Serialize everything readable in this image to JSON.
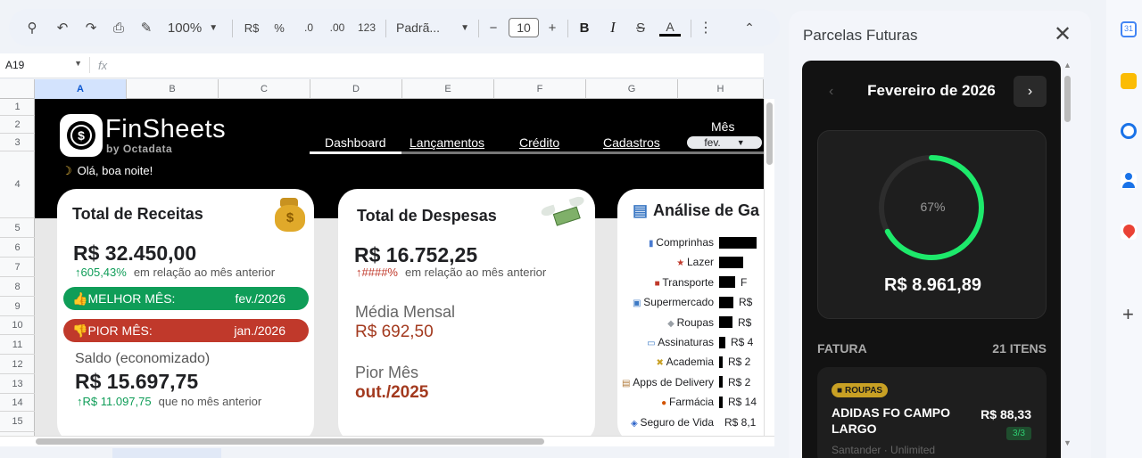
{
  "toolbar": {
    "zoom": "100%",
    "currency": "R$",
    "percent": "%",
    "dec_less": ".0",
    "dec_more": ".00",
    "num_format": "123",
    "font": "Padrã...",
    "font_size": "10",
    "bold": "B",
    "italic": "I",
    "strike": "S",
    "text_color": "A"
  },
  "formula_bar": {
    "cell_ref": "A19",
    "fx": "fx"
  },
  "columns": [
    "A",
    "B",
    "C",
    "D",
    "E",
    "F",
    "G",
    "H"
  ],
  "rows": [
    "1",
    "2",
    "3",
    "4",
    "5",
    "6",
    "7",
    "8",
    "9",
    "10",
    "11",
    "12",
    "13",
    "14",
    "15"
  ],
  "dashboard": {
    "logo_title": "FinSheets",
    "logo_sub": "by Octadata",
    "greeting": "Olá, boa noite!",
    "nav": [
      "Dashboard",
      "Lançamentos",
      "Crédito",
      "Cadastros"
    ],
    "month_label": "Mês",
    "month_value": "fev.",
    "receitas": {
      "title": "Total de Receitas",
      "value": "R$ 32.450,00",
      "change": "605,43%",
      "change_note": "em relação ao mês anterior",
      "best_label": "MELHOR MÊS:",
      "best_value": "fev./2026",
      "worst_label": "PIOR MÊS:",
      "worst_value": "jan./2026",
      "saldo_label": "Saldo (economizado)",
      "saldo_value": "R$ 15.697,75",
      "saldo_change": "R$ 11.097,75",
      "saldo_note": "que no mês anterior"
    },
    "despesas": {
      "title": "Total de Despesas",
      "value": "R$ 16.752,25",
      "change": "####%",
      "change_note": "em relação ao mês anterior",
      "media_label": "Média Mensal",
      "media_value": "R$ 692,50",
      "pior_label": "Pior Mês",
      "pior_value": "out./2025"
    },
    "analise": {
      "title": "Análise de Ga",
      "items": [
        {
          "label": "Comprinhas",
          "value": "",
          "bar": 0.95,
          "icon": "bag-icon"
        },
        {
          "label": "Lazer",
          "value": "",
          "bar": 0.62,
          "icon": "party-icon"
        },
        {
          "label": "Transporte",
          "value": "F",
          "bar": 0.4,
          "icon": "truck-icon"
        },
        {
          "label": "Supermercado",
          "value": "R$",
          "bar": 0.36,
          "icon": "cart-icon"
        },
        {
          "label": "Roupas",
          "value": "R$",
          "bar": 0.34,
          "icon": "shirt-icon"
        },
        {
          "label": "Assinaturas",
          "value": "R$ 4",
          "bar": 0.17,
          "icon": "screen-icon"
        },
        {
          "label": "Academia",
          "value": "R$ 2",
          "bar": 0.1,
          "icon": "dumbbell-icon"
        },
        {
          "label": "Apps de Delivery",
          "value": "R$ 2",
          "bar": 0.1,
          "icon": "box-icon"
        },
        {
          "label": "Farmácia",
          "value": "R$ 14",
          "bar": 0.08,
          "icon": "pill-icon"
        },
        {
          "label": "Seguro de Vida",
          "value": "R$ 8,1",
          "bar": 0,
          "icon": "shield-icon"
        }
      ]
    }
  },
  "panel": {
    "title": "Parcelas Futuras",
    "month": "Fevereiro de 2026",
    "progress_label": "67%",
    "progress": 0.67,
    "total": "R$ 8.961,89",
    "fatura_label": "FATURA",
    "items_count": "21 ITENS",
    "item": {
      "tag": "ROUPAS",
      "name": "ADIDAS FO CAMPO LARGO",
      "amount": "R$ 88,33",
      "installment": "3/3",
      "sub": "Santander · Unlimited"
    }
  },
  "colors": {
    "green": "#0f9d58",
    "red": "#c0392b",
    "accent": "#1de96b"
  }
}
